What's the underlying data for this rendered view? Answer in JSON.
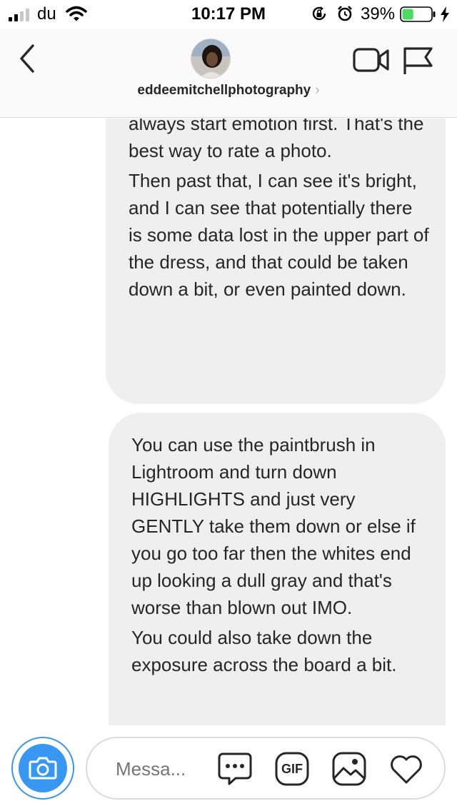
{
  "status_bar": {
    "carrier": "du",
    "time": "10:17 PM",
    "battery_percent": "39%",
    "battery_level": 0.39,
    "battery_color": "#4cd964"
  },
  "header": {
    "username": "eddeemitchellphotography",
    "chevron": "›",
    "icons": [
      "back-chevron-icon",
      "video-camera-icon",
      "flag-icon"
    ]
  },
  "messages": [
    {
      "paragraphs": [
        "always start emotion first. That's the best way to rate a photo.",
        "Then past that, I can see it's bright, and I can see that potentially there is some data lost in the upper part of the dress, and that could be taken down a bit, or even painted down."
      ]
    },
    {
      "paragraphs": [
        "You can use the paintbrush in Lightroom and turn down HIGHLIGHTS and just very GENTLY take them down or else if you go too far then the whites end up looking a dull gray and that's worse than blown out IMO.",
        "You could also take down the exposure across the board a bit."
      ]
    }
  ],
  "composer": {
    "placeholder": "Messa...",
    "gif_label": "GIF",
    "accent_color": "#3897f0",
    "icons": [
      "camera-icon",
      "sticker-icon",
      "gif-icon",
      "gallery-icon",
      "heart-icon"
    ]
  }
}
